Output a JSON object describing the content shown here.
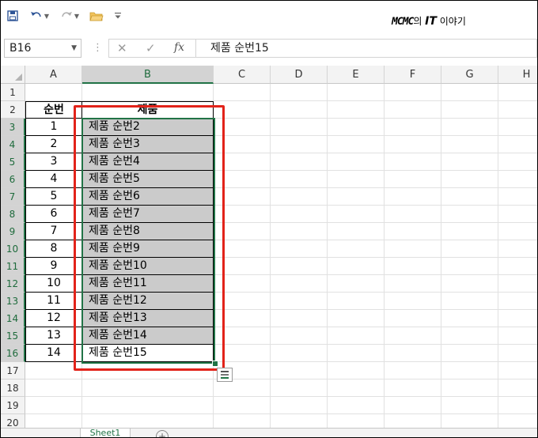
{
  "toolbar": {
    "brand_a": "MCMC",
    "brand_b": "의 ",
    "brand_c": "IT",
    "brand_d": " 이야기"
  },
  "formula_bar": {
    "name_box": "B16",
    "formula_value": "제품 순번15"
  },
  "columns": [
    "A",
    "B",
    "C",
    "D",
    "E",
    "F",
    "G",
    "H"
  ],
  "rows": [
    "1",
    "2",
    "3",
    "4",
    "5",
    "6",
    "7",
    "8",
    "9",
    "10",
    "11",
    "12",
    "13",
    "14",
    "15",
    "16",
    "17",
    "18",
    "19",
    "20"
  ],
  "table": {
    "header_a": "순번",
    "header_b": "제품",
    "rows": [
      {
        "num": "1",
        "product": "제품 순번2"
      },
      {
        "num": "2",
        "product": "제품 순번3"
      },
      {
        "num": "3",
        "product": "제품 순번4"
      },
      {
        "num": "4",
        "product": "제품 순번5"
      },
      {
        "num": "5",
        "product": "제품 순번6"
      },
      {
        "num": "6",
        "product": "제품 순번7"
      },
      {
        "num": "7",
        "product": "제품 순번8"
      },
      {
        "num": "8",
        "product": "제품 순번9"
      },
      {
        "num": "9",
        "product": "제품 순번10"
      },
      {
        "num": "10",
        "product": "제품 순번11"
      },
      {
        "num": "11",
        "product": "제품 순번12"
      },
      {
        "num": "12",
        "product": "제품 순번13"
      },
      {
        "num": "13",
        "product": "제품 순번14"
      },
      {
        "num": "14",
        "product": "제품 순번15"
      }
    ]
  },
  "sheet_tabs": {
    "active": "Sheet1",
    "add_label": "+"
  },
  "colors": {
    "excel_green": "#217346",
    "highlight_red": "#e2231a",
    "cell_gray": "#cbcbcb"
  },
  "icons": [
    "save-icon",
    "undo-icon",
    "redo-icon",
    "open-folder-icon",
    "customize-toolbar-icon",
    "cancel-icon",
    "enter-icon",
    "function-icon",
    "auto-fill-options-icon"
  ]
}
